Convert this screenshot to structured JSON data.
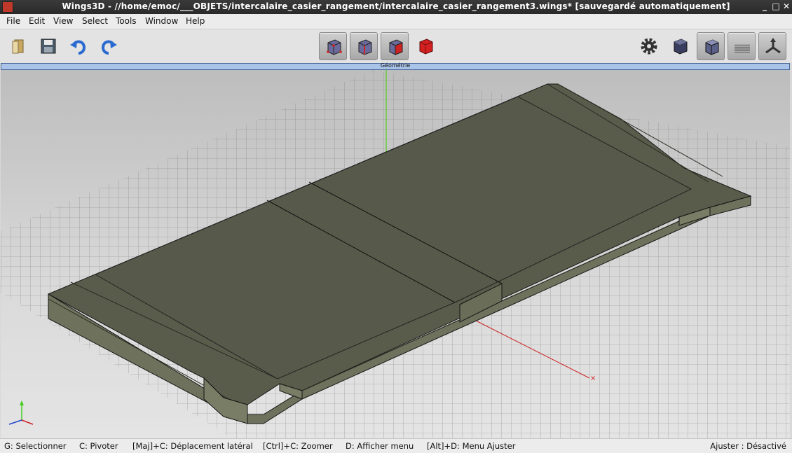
{
  "window": {
    "title": "Wings3D - //home/emoc/___OBJETS/intercalaire_casier_rangement/intercalaire_casier_rangement3.wings* [sauvegardé automatiquement]",
    "minimize": "_",
    "maximize": "□",
    "close": "✕"
  },
  "menubar": {
    "file": "File",
    "edit": "Edit",
    "view": "View",
    "select": "Select",
    "tools": "Tools",
    "window": "Window",
    "help": "Help"
  },
  "toolbar": {
    "icons": [
      "open-icon",
      "save-icon",
      "undo-icon",
      "redo-icon",
      "vertex-mode-icon",
      "edge-mode-icon",
      "face-mode-icon",
      "body-mode-icon",
      "preferences-gear-icon",
      "smooth-shaded-icon",
      "flat-shaded-icon",
      "groundplane-toggle-icon",
      "orthogonal-axes-icon"
    ],
    "selected_mode": "face",
    "accent": "#cc2222"
  },
  "viewport": {
    "header_label": "Géométrie",
    "background_top": "#bdbdbd",
    "model_color": "#5a5c4b"
  },
  "statusbar": {
    "select": "G: Selectionner",
    "rotate": "C: Pivoter",
    "pan": "[Maj]+C: Déplacement latéral",
    "zoom": "[Ctrl]+C: Zoomer",
    "menu": "D: Afficher menu",
    "adjust_menu": "[Alt]+D: Menu Ajuster",
    "adjust_state": "Ajuster : Désactivé"
  }
}
